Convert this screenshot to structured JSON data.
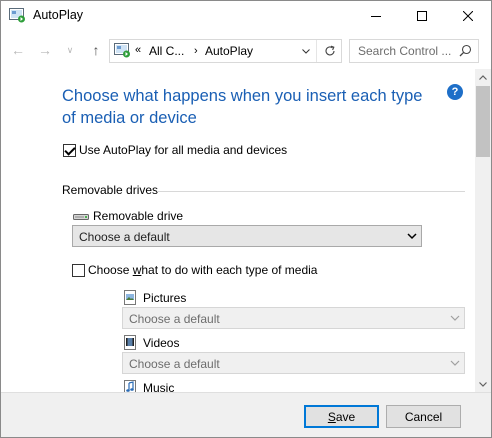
{
  "window": {
    "title": "AutoPlay"
  },
  "address_bar": {
    "crumb_overflow": "«",
    "crumbs": [
      "All C...",
      "AutoPlay"
    ],
    "search_placeholder": "Search Control ..."
  },
  "content": {
    "heading": "Choose what happens when you insert each type of media or device",
    "use_autoplay": {
      "label": "Use AutoPlay for all media and devices",
      "checked": true
    },
    "removable_section": {
      "title": "Removable drives",
      "drive_label": "Removable drive",
      "drive_select": "Choose a default",
      "per_media": {
        "label_prefix": "Choose ",
        "label_accel": "w",
        "label_suffix": "hat to do with each type of media",
        "checked": false
      },
      "media": [
        {
          "label": "Pictures",
          "icon": "pictures-icon",
          "select": "Choose a default"
        },
        {
          "label": "Videos",
          "icon": "videos-icon",
          "select": "Choose a default"
        },
        {
          "label": "Music",
          "icon": "music-icon"
        }
      ]
    }
  },
  "footer": {
    "save_accel": "S",
    "save_rest": "ave",
    "cancel_label": "Cancel"
  },
  "colors": {
    "heading": "#1a5fb4",
    "help_icon": "#1e6fc8",
    "default_button_border": "#0078d7"
  }
}
